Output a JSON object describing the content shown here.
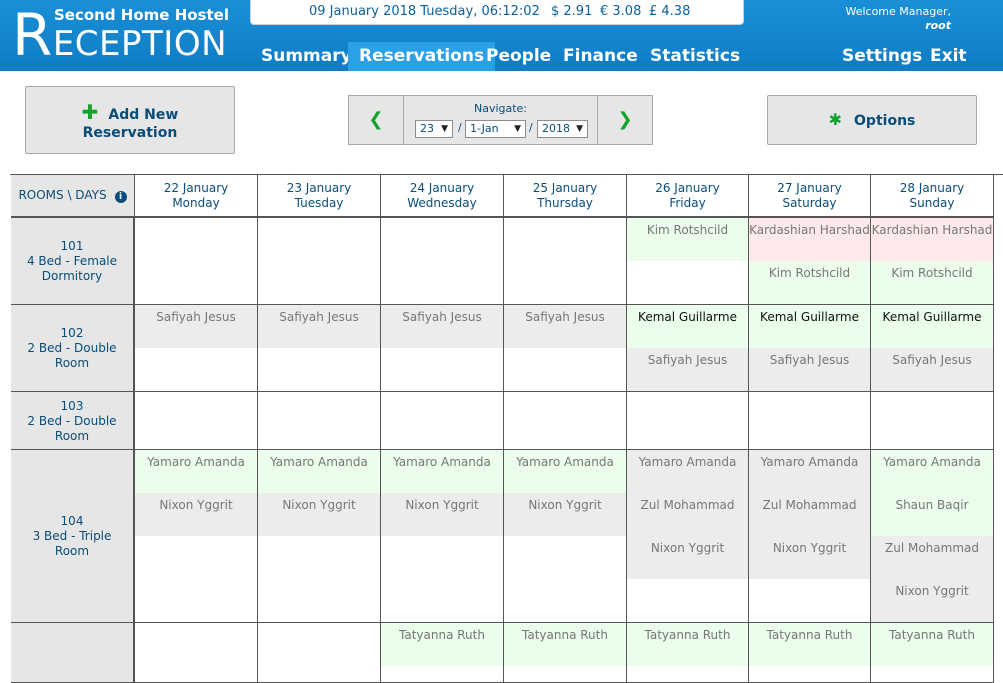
{
  "header": {
    "hostel_name": "Second Home Hostel",
    "app_title_cap": "R",
    "app_title_rest": "ECEPTION",
    "datetime": "09 January 2018 Tuesday, 06:12:02",
    "rates": {
      "usd": "$ 2.91",
      "eur": "€ 3.08",
      "gbp": "£ 4.38"
    },
    "welcome": "Welcome Manager,",
    "user": "root",
    "nav": [
      "Summary",
      "Reservations",
      "People",
      "Finance",
      "Statistics",
      "Settings",
      "Exit"
    ],
    "active_nav": "Reservations"
  },
  "toolbar": {
    "add_line1": "Add New",
    "add_line2": "Reservation",
    "add_icon": "plus-icon",
    "navigate_label": "Navigate:",
    "day": "23",
    "month": "1-Jan",
    "year": "2018",
    "slash": "/",
    "options_label": "Options",
    "options_icon": "asterisk-icon"
  },
  "grid": {
    "corner_label": "ROOMS \\ DAYS",
    "days": [
      {
        "date": "22 January",
        "weekday": "Monday"
      },
      {
        "date": "23 January",
        "weekday": "Tuesday"
      },
      {
        "date": "24 January",
        "weekday": "Wednesday"
      },
      {
        "date": "25 January",
        "weekday": "Thursday"
      },
      {
        "date": "26 January",
        "weekday": "Friday"
      },
      {
        "date": "27 January",
        "weekday": "Saturday"
      },
      {
        "date": "28 January",
        "weekday": "Sunday"
      }
    ],
    "rooms": [
      {
        "number": "101",
        "line1": "4 Bed - Female",
        "line2": "Dormitory",
        "days": [
          [],
          [],
          [],
          [],
          [
            {
              "name": "Kim Rotshcild",
              "style": "green"
            }
          ],
          [
            {
              "name": "Kardashian Harshad",
              "style": "pink"
            },
            {
              "name": "Kim Rotshcild",
              "style": "green"
            }
          ],
          [
            {
              "name": "Kardashian Harshad",
              "style": "pink"
            },
            {
              "name": "Kim Rotshcild",
              "style": "green"
            }
          ]
        ]
      },
      {
        "number": "102",
        "line1": "2 Bed - Double",
        "line2": "Room",
        "days": [
          [
            {
              "name": "Safiyah Jesus",
              "style": "gray"
            }
          ],
          [
            {
              "name": "Safiyah Jesus",
              "style": "gray"
            }
          ],
          [
            {
              "name": "Safiyah Jesus",
              "style": "gray"
            }
          ],
          [
            {
              "name": "Safiyah Jesus",
              "style": "gray"
            }
          ],
          [
            {
              "name": "Kemal Guillarme",
              "style": "green-strong"
            },
            {
              "name": "Safiyah Jesus",
              "style": "gray"
            }
          ],
          [
            {
              "name": "Kemal Guillarme",
              "style": "green-strong"
            },
            {
              "name": "Safiyah Jesus",
              "style": "gray"
            }
          ],
          [
            {
              "name": "Kemal Guillarme",
              "style": "green-strong"
            },
            {
              "name": "Safiyah Jesus",
              "style": "gray"
            }
          ]
        ]
      },
      {
        "number": "103",
        "line1": "2 Bed - Double",
        "line2": "Room",
        "days": [
          [],
          [],
          [],
          [],
          [],
          [],
          []
        ]
      },
      {
        "number": "104",
        "line1": "3 Bed - Triple",
        "line2": "Room",
        "days": [
          [
            {
              "name": "Yamaro Amanda",
              "style": "green"
            },
            {
              "name": "Nixon Yggrit",
              "style": "gray"
            }
          ],
          [
            {
              "name": "Yamaro Amanda",
              "style": "green"
            },
            {
              "name": "Nixon Yggrit",
              "style": "gray"
            }
          ],
          [
            {
              "name": "Yamaro Amanda",
              "style": "green"
            },
            {
              "name": "Nixon Yggrit",
              "style": "gray"
            }
          ],
          [
            {
              "name": "Yamaro Amanda",
              "style": "green"
            },
            {
              "name": "Nixon Yggrit",
              "style": "gray"
            }
          ],
          [
            {
              "name": "Yamaro Amanda",
              "style": "gray"
            },
            {
              "name": "Zul Mohammad",
              "style": "gray"
            },
            {
              "name": "Nixon Yggrit",
              "style": "gray"
            }
          ],
          [
            {
              "name": "Yamaro Amanda",
              "style": "gray"
            },
            {
              "name": "Zul Mohammad",
              "style": "gray"
            },
            {
              "name": "Nixon Yggrit",
              "style": "gray"
            }
          ],
          [
            {
              "name": "Yamaro Amanda",
              "style": "green"
            },
            {
              "name": "Shaun Baqir",
              "style": "green"
            },
            {
              "name": "Zul Mohammad",
              "style": "gray"
            },
            {
              "name": "Nixon Yggrit",
              "style": "gray"
            }
          ]
        ]
      },
      {
        "number": "",
        "line1": "",
        "line2": "",
        "days": [
          [],
          [],
          [
            {
              "name": "Tatyanna Ruth",
              "style": "green"
            }
          ],
          [
            {
              "name": "Tatyanna Ruth",
              "style": "green"
            }
          ],
          [
            {
              "name": "Tatyanna Ruth",
              "style": "green"
            }
          ],
          [
            {
              "name": "Tatyanna Ruth",
              "style": "green"
            }
          ],
          [
            {
              "name": "Tatyanna Ruth",
              "style": "green"
            }
          ]
        ]
      }
    ]
  }
}
